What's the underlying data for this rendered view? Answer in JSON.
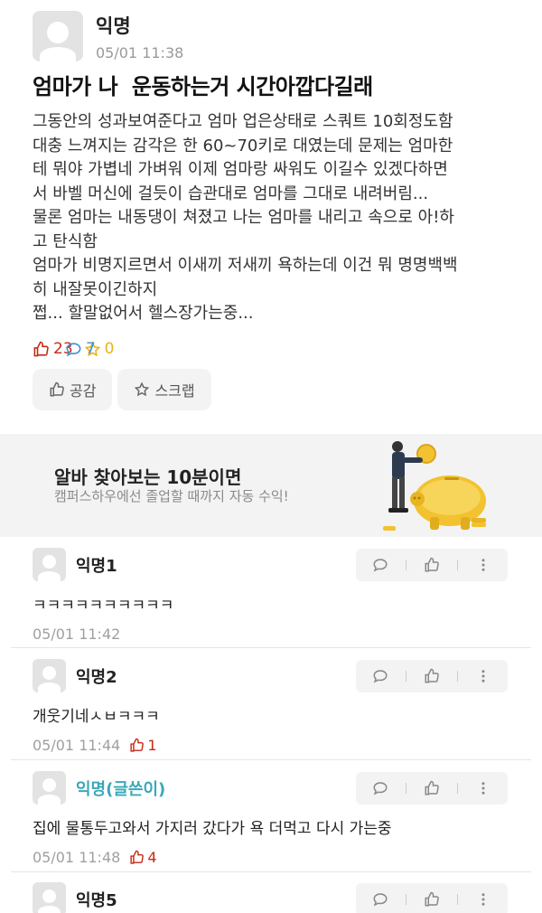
{
  "post": {
    "author": "익명",
    "time": "05/01 11:38",
    "title": "엄마가 나  운동하는거 시간아깝다길래",
    "body_lines": [
      "그동안의 성과보여준다고 엄마 업은상태로 스쿼트 10회정도함",
      "대충 느껴지는 감각은 한 60~70키로 대였는데 문제는 엄마한",
      "테 뭐야 가볍네 가벼워 이제 엄마랑 싸워도 이길수 있겠다하면",
      "서 바벨 머신에 걸듯이 습관대로 엄마를 그대로 내려버림...",
      "물론 엄마는 내동댕이 쳐졌고 나는 엄마를 내리고 속으로 아!하",
      "고 탄식함",
      "엄마가 비명지르면서 이새끼 저새끼 욕하는데 이건 뭐 명명백백",
      "히 내잘못이긴하지",
      "쩝... 할말없어서 헬스장가는중..."
    ],
    "likes": "23",
    "comments": "7",
    "scraps": "0",
    "like_button": "공감",
    "scrap_button": "스크랩"
  },
  "ad": {
    "title": "알바 찾아보는 10분이면",
    "subtitle": "캠퍼스하우에선 졸업할 때까지 자동 수익!"
  },
  "comments": [
    {
      "author": "익명1",
      "text": "ㅋㅋㅋㅋㅋㅋㅋㅋㅋㅋ",
      "time": "05/01 11:42",
      "likes": ""
    },
    {
      "author": "익명2",
      "text": "개웃기네ㅅㅂㅋㅋㅋ",
      "time": "05/01 11:44",
      "likes": "1"
    },
    {
      "author": "익명(글쓴이)",
      "text": "집에 물통두고와서 가지러 갔다가 욕 더먹고 다시 가는중",
      "time": "05/01 11:48",
      "likes": "4"
    },
    {
      "author": "익명5",
      "text": "",
      "time": "",
      "likes": ""
    }
  ],
  "colors": {
    "like": "#c62917",
    "comment": "#3a8fd6",
    "scrap": "#e8b317",
    "op_name": "#3aa8b8"
  },
  "icons": [
    "thumb-up-icon",
    "speech-bubble-icon",
    "star-icon",
    "more-vertical-icon",
    "avatar-icon",
    "piggy-bank-illustration"
  ]
}
